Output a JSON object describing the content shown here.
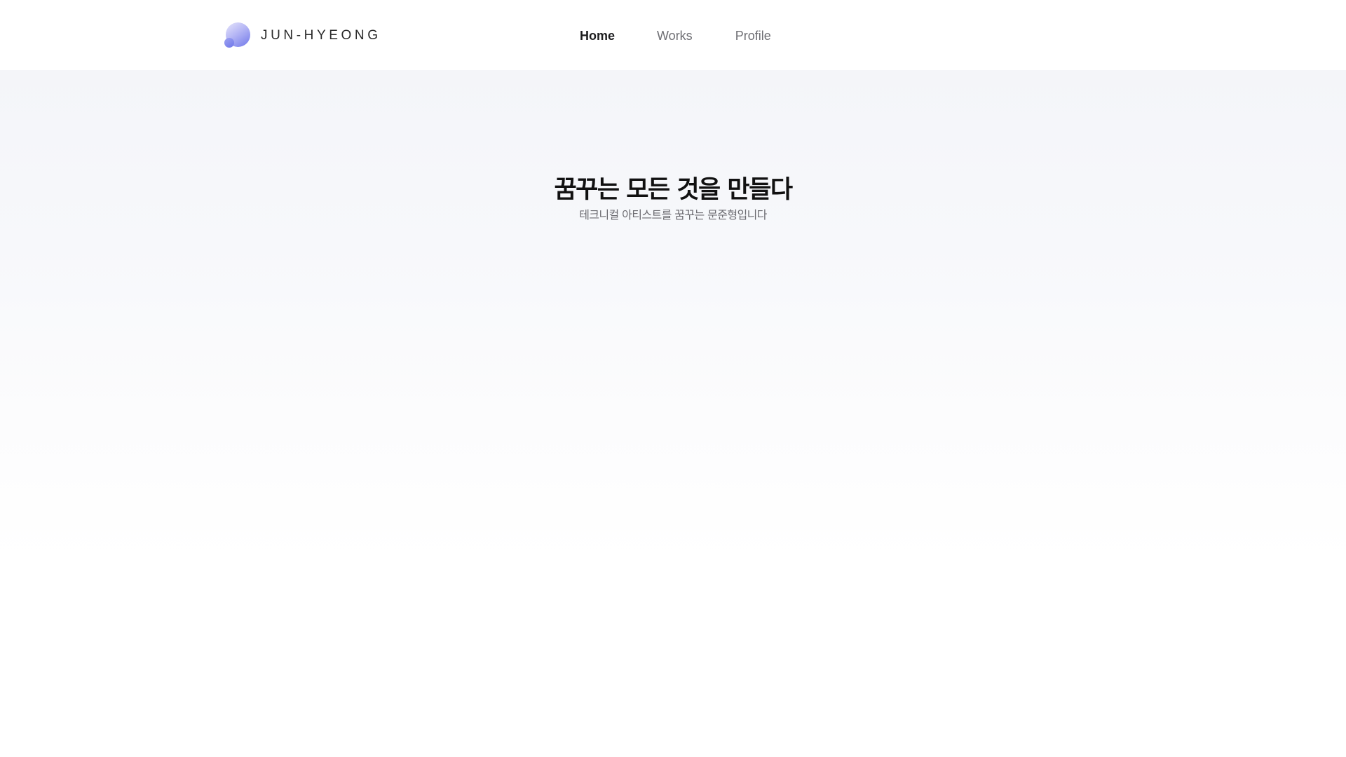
{
  "brand": {
    "name": "JUN-HYEONG",
    "logo_icon": "gradient-blob-icon",
    "logo_colors": [
      "#e7e6fb",
      "#b5b6f5",
      "#6f77ea"
    ]
  },
  "nav": {
    "items": [
      {
        "label": "Home",
        "active": true
      },
      {
        "label": "Works",
        "active": false
      },
      {
        "label": "Profile",
        "active": false
      }
    ]
  },
  "hero": {
    "title": "꿈꾸는 모든 것을 만들다",
    "subtitle": "테크니컬 아티스트를 꿈꾸는 문준형입니다"
  },
  "colors": {
    "text_primary": "#111111",
    "text_secondary": "#6b6b70",
    "nav_inactive": "#6e6e73",
    "hero_background": "#f4f5f9"
  }
}
